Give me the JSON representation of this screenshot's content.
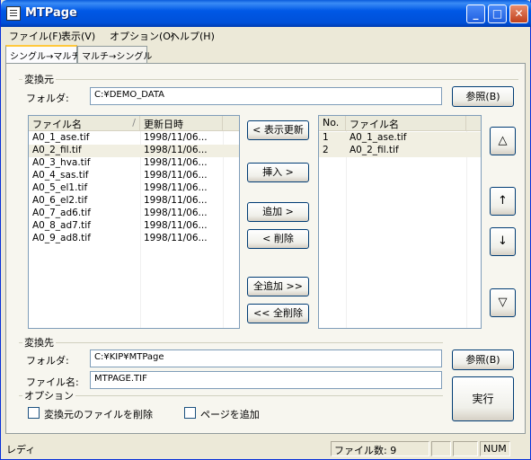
{
  "window": {
    "title": "MTPage"
  },
  "menu": [
    "ファイル(F)",
    "表示(V)",
    "オプション(O)",
    "ヘルプ(H)"
  ],
  "tabs": [
    "シングル→マルチ",
    "マルチ→シングル"
  ],
  "source": {
    "group_label": "変換元",
    "folder_label": "フォルダ:",
    "folder_value": "C:¥DEMO_DATA",
    "browse_label": "参照(B)"
  },
  "file_list": {
    "columns": [
      "ファイル名",
      "更新日時"
    ],
    "sort_indicator": "/",
    "rows": [
      {
        "name": "A0_1_ase.tif",
        "date": "1998/11/06..."
      },
      {
        "name": "A0_2_fil.tif",
        "date": "1998/11/06..."
      },
      {
        "name": "A0_3_hva.tif",
        "date": "1998/11/06..."
      },
      {
        "name": "A0_4_sas.tif",
        "date": "1998/11/06..."
      },
      {
        "name": "A0_5_el1.tif",
        "date": "1998/11/06..."
      },
      {
        "name": "A0_6_el2.tif",
        "date": "1998/11/06..."
      },
      {
        "name": "A0_7_ad6.tif",
        "date": "1998/11/06..."
      },
      {
        "name": "A0_8_ad7.tif",
        "date": "1998/11/06..."
      },
      {
        "name": "A0_9_ad8.tif",
        "date": "1998/11/06..."
      }
    ]
  },
  "middle_buttons": {
    "refresh": "< 表示更新",
    "insert": "挿入 >",
    "add": "追加 >",
    "delete": "< 削除",
    "add_all": "全追加 >>",
    "delete_all": "<< 全削除"
  },
  "selected_list": {
    "columns": [
      "No.",
      "ファイル名"
    ],
    "rows": [
      {
        "no": "1",
        "name": "A0_1_ase.tif"
      },
      {
        "no": "2",
        "name": "A0_2_fil.tif"
      }
    ]
  },
  "order_buttons": {
    "top": "△",
    "up": "↑",
    "down": "↓",
    "bottom": "▽"
  },
  "destination": {
    "group_label": "変換先",
    "folder_label": "フォルダ:",
    "folder_value": "C:¥KIP¥MTPage",
    "filename_label": "ファイル名:",
    "filename_value": "MTPAGE.TIF",
    "browse_label": "参照(B)"
  },
  "options": {
    "group_label": "オプション",
    "delete_source_label": "変換元のファイルを削除",
    "delete_source_checked": false,
    "add_page_label": "ページを追加",
    "add_page_checked": false
  },
  "run_label": "実行",
  "status": {
    "text": "レディ",
    "file_count": "ファイル数: 9",
    "num": "NUM"
  }
}
